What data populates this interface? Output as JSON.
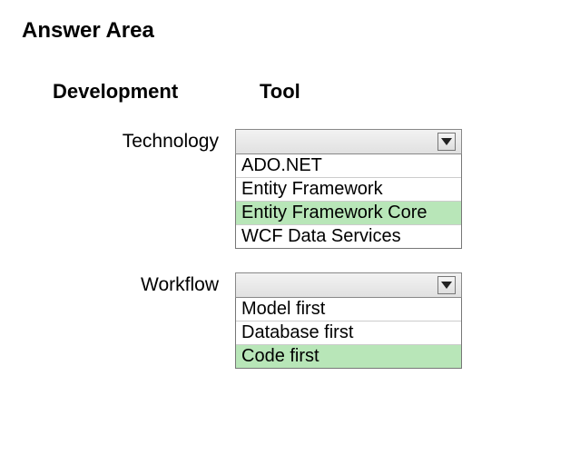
{
  "title": "Answer Area",
  "headers": {
    "left": "Development",
    "right": "Tool"
  },
  "fields": {
    "technology": {
      "label": "Technology",
      "options": [
        {
          "label": "ADO.NET",
          "highlighted": false
        },
        {
          "label": "Entity Framework",
          "highlighted": false
        },
        {
          "label": "Entity Framework Core",
          "highlighted": true
        },
        {
          "label": "WCF Data Services",
          "highlighted": false
        }
      ]
    },
    "workflow": {
      "label": "Workflow",
      "options": [
        {
          "label": "Model first",
          "highlighted": false
        },
        {
          "label": "Database first",
          "highlighted": false
        },
        {
          "label": "Code first",
          "highlighted": true
        }
      ]
    }
  }
}
